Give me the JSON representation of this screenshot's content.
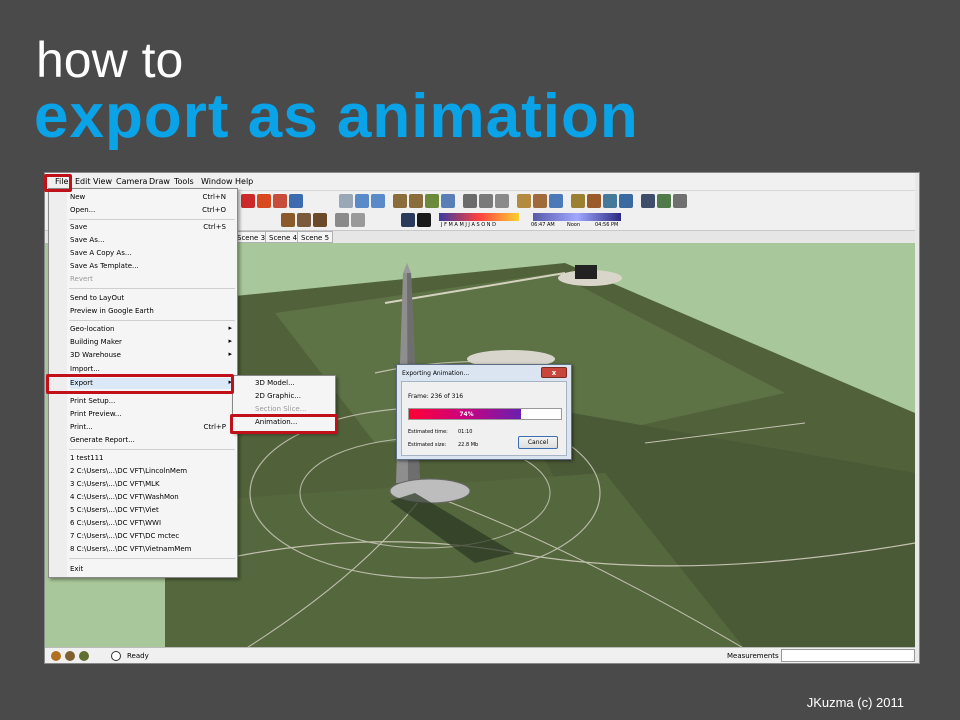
{
  "slide": {
    "title_line1": "how to",
    "title_line2": "export as animation",
    "footer": "JKuzma (c) 2011",
    "title_color": "#ffffff",
    "accent_color": "#0aa3e8"
  },
  "app": {
    "menubar": [
      "File",
      "Edit",
      "View",
      "Camera",
      "Draw",
      "Tools",
      "Window",
      "Help"
    ],
    "scenes": [
      "Scene 3",
      "Scene 4",
      "Scene 5"
    ],
    "shadow_months": "J F M A M J J A S O N D",
    "shadow_time_start": "06:47 AM",
    "shadow_time_mid": "Noon",
    "shadow_time_end": "04:56 PM",
    "status_ready": "Ready",
    "measurements_label": "Measurements"
  },
  "file_menu": {
    "items": [
      {
        "label": "New",
        "shortcut": "Ctrl+N"
      },
      {
        "label": "Open...",
        "shortcut": "Ctrl+O"
      },
      {
        "label": "Save",
        "shortcut": "Ctrl+S"
      },
      {
        "label": "Save As...",
        "shortcut": ""
      },
      {
        "label": "Save A Copy As...",
        "shortcut": ""
      },
      {
        "label": "Save As Template...",
        "shortcut": ""
      },
      {
        "label": "Revert",
        "shortcut": ""
      },
      {
        "label": "Send to LayOut",
        "shortcut": ""
      },
      {
        "label": "Preview in Google Earth",
        "shortcut": ""
      },
      {
        "label": "Geo-location",
        "shortcut": ""
      },
      {
        "label": "Building Maker",
        "shortcut": ""
      },
      {
        "label": "3D Warehouse",
        "shortcut": ""
      },
      {
        "label": "Import...",
        "shortcut": ""
      },
      {
        "label": "Export",
        "shortcut": ""
      },
      {
        "label": "Print Setup...",
        "shortcut": ""
      },
      {
        "label": "Print Preview...",
        "shortcut": ""
      },
      {
        "label": "Print...",
        "shortcut": "Ctrl+P"
      },
      {
        "label": "Generate Report...",
        "shortcut": ""
      },
      {
        "label": "1 test111",
        "shortcut": ""
      },
      {
        "label": "2 C:\\Users\\...\\DC VFT\\LincolnMem",
        "shortcut": ""
      },
      {
        "label": "3 C:\\Users\\...\\DC VFT\\MLK",
        "shortcut": ""
      },
      {
        "label": "4 C:\\Users\\...\\DC VFT\\WashMon",
        "shortcut": ""
      },
      {
        "label": "5 C:\\Users\\...\\DC VFT\\Viet",
        "shortcut": ""
      },
      {
        "label": "6 C:\\Users\\...\\DC VFT\\WWI",
        "shortcut": ""
      },
      {
        "label": "7 C:\\Users\\...\\DC VFT\\DC mctec",
        "shortcut": ""
      },
      {
        "label": "8 C:\\Users\\...\\DC VFT\\VietnamMem",
        "shortcut": ""
      },
      {
        "label": "Exit",
        "shortcut": ""
      }
    ]
  },
  "export_submenu": {
    "items": [
      "3D Model...",
      "2D Graphic...",
      "Section Slice...",
      "Animation..."
    ]
  },
  "dialog": {
    "title": "Exporting Animation...",
    "close": "x",
    "frame": "Frame: 236 of 316",
    "progress_text": "74%",
    "progress_fraction": 0.74,
    "time_label": "Estimated time:",
    "time_value": "01:10",
    "size_label": "Estimated size:",
    "size_value": "22.8 Mb",
    "cancel": "Cancel"
  }
}
